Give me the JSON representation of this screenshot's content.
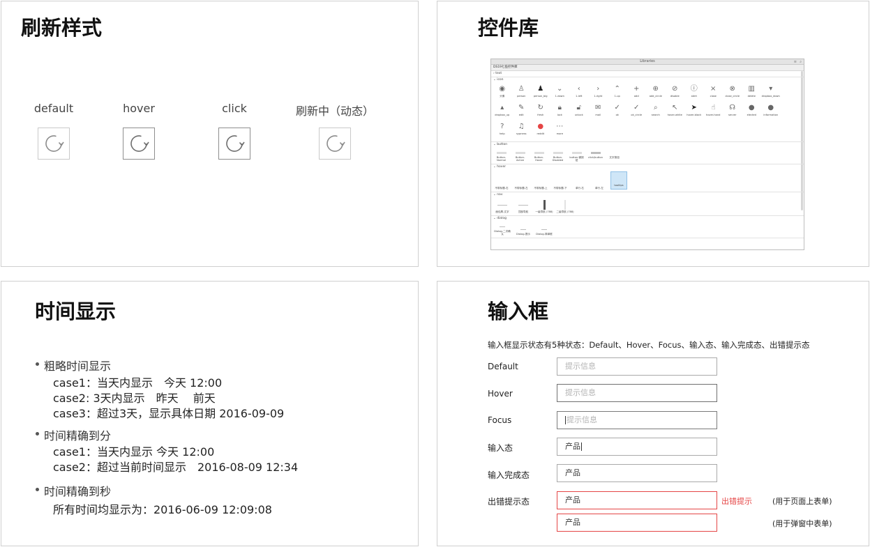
{
  "refresh": {
    "title": "刷新样式",
    "states": [
      {
        "label": "default"
      },
      {
        "label": "hover"
      },
      {
        "label": "click"
      },
      {
        "label": "刷新中（动态）"
      }
    ]
  },
  "library": {
    "title": "控件库",
    "window_title": "Libraries",
    "selected_library": "DS19七鱼控件库",
    "sections": {
      "text": "text",
      "icon": "icon",
      "button": "button",
      "hover": "hover",
      "nav": "nav",
      "dialog": "dialog"
    },
    "icons": [
      {
        "glyph": "◉",
        "label": "头像"
      },
      {
        "glyph": "♙",
        "label": "person"
      },
      {
        "glyph": "♟",
        "label": "person_big"
      },
      {
        "glyph": "⌄",
        "label": "1-down"
      },
      {
        "glyph": "‹",
        "label": "1-left"
      },
      {
        "glyph": "›",
        "label": "1-right"
      },
      {
        "glyph": "⌃",
        "label": "1-up"
      },
      {
        "glyph": "+",
        "label": "add"
      },
      {
        "glyph": "⊕",
        "label": "add_circle"
      },
      {
        "glyph": "⊘",
        "label": "disable"
      },
      {
        "glyph": "ⓘ",
        "label": "alert"
      },
      {
        "glyph": "×",
        "label": "close"
      },
      {
        "glyph": "⊗",
        "label": "close_circle"
      },
      {
        "glyph": "▥",
        "label": "delete"
      },
      {
        "glyph": "▾",
        "label": "dropbox_down"
      },
      {
        "glyph": "▴",
        "label": "dropbox_up"
      },
      {
        "glyph": "✎",
        "label": "edit"
      },
      {
        "glyph": "↻",
        "label": "fresh"
      },
      {
        "glyph": "🔒︎",
        "label": "lock"
      },
      {
        "glyph": "🔓︎",
        "label": "unlock"
      },
      {
        "glyph": "✉",
        "label": "mail"
      },
      {
        "glyph": "✓",
        "label": "ok"
      },
      {
        "glyph": "✓",
        "label": "ok_circle"
      },
      {
        "glyph": "⌕",
        "label": "search"
      },
      {
        "glyph": "↖",
        "label": "hover-white"
      },
      {
        "glyph": "➤",
        "label": "hover-black"
      },
      {
        "glyph": "☝",
        "label": "hover-hand"
      },
      {
        "glyph": "☊",
        "label": "server"
      },
      {
        "glyph": "●",
        "label": "elected"
      },
      {
        "glyph": "●",
        "label": "information"
      },
      {
        "glyph": "?",
        "label": "help"
      },
      {
        "glyph": "♫",
        "label": "sypness"
      },
      {
        "glyph": "●",
        "label": "reddit"
      },
      {
        "glyph": "⋯",
        "label": "more"
      }
    ],
    "buttons": [
      {
        "label": "Button-Normal"
      },
      {
        "label": "Button-Active"
      },
      {
        "label": "Button-Hover"
      },
      {
        "label": "Button-Disabled"
      },
      {
        "label": "button-微按钮"
      },
      {
        "label": "click/button"
      },
      {
        "label": "文字按钮"
      }
    ],
    "hovers": [
      {
        "label": "不带标题-右"
      },
      {
        "label": "不带标题-左"
      },
      {
        "label": "不带标题-上"
      },
      {
        "label": "不带标题-下"
      },
      {
        "label": "单行-右"
      },
      {
        "label": "单行-左"
      },
      {
        "label": "tooltips"
      }
    ],
    "navs": [
      {
        "label": "面包屑-文字"
      },
      {
        "label": "顶部导航"
      },
      {
        "label": "一级导航 (788)"
      },
      {
        "label": "二级导航 (788)"
      }
    ],
    "dialogs": [
      {
        "label": "Dialog-二次确认"
      },
      {
        "label": "Dialog-提示"
      },
      {
        "label": "Dialog-简单框"
      }
    ]
  },
  "time": {
    "title": "时间显示",
    "groups": [
      {
        "head": "粗略时间显示",
        "cases": [
          "case1：当天内显示　今天 12:00",
          "case2: 3天内显示　昨天　 前天",
          "case3：超过3天，显示具体日期 2016-09-09"
        ]
      },
      {
        "head": "时间精确到分",
        "cases": [
          "case1：当天内显示  今天 12:00",
          "case2：超过当前时间显示　2016-08-09 12:34"
        ]
      },
      {
        "head": "时间精确到秒",
        "cases": [
          "所有时间均显示为：2016-06-09 12:09:08"
        ]
      }
    ]
  },
  "input": {
    "title": "输入框",
    "intro": "输入框显示状态有5种状态：Default、Hover、Focus、输入态、输入完成态、出错提示态",
    "fields": [
      {
        "label": "Default",
        "text": "提示信息"
      },
      {
        "label": "Hover",
        "text": "提示信息"
      },
      {
        "label": "Focus",
        "text": "提示信息"
      },
      {
        "label": "输入态",
        "text": "产品"
      },
      {
        "label": "输入完成态",
        "text": "产品"
      },
      {
        "label": "出错提示态",
        "text": "产品"
      }
    ],
    "extra_field_text": "产品",
    "error_tip": "出错提示",
    "note_page": "(用于页面上表单)",
    "note_dialog": "(用于弹窗中表单)",
    "colors": {
      "error": "#e54545",
      "placeholder": "#b3b3b3"
    }
  }
}
